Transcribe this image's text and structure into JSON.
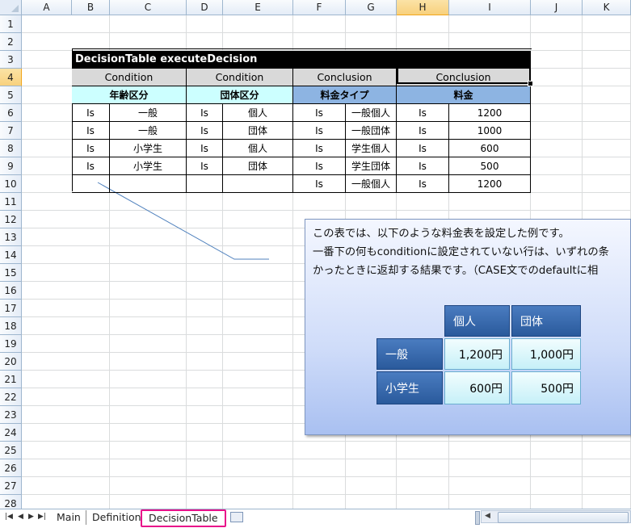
{
  "columns": [
    "A",
    "B",
    "C",
    "D",
    "E",
    "F",
    "G",
    "H",
    "I",
    "J",
    "K"
  ],
  "rows": [
    "1",
    "2",
    "3",
    "4",
    "5",
    "6",
    "7",
    "8",
    "9",
    "10",
    "11",
    "12",
    "13",
    "14",
    "15",
    "16",
    "17",
    "18",
    "19",
    "20",
    "21",
    "22",
    "23",
    "24",
    "25",
    "26",
    "27",
    "28"
  ],
  "selected_column": "H",
  "selected_row": "4",
  "decision_table": {
    "title": "DecisionTable executeDecision",
    "types": [
      "Condition",
      "Condition",
      "Conclusion",
      "Conclusion"
    ],
    "headers": [
      "年齢区分",
      "団体区分",
      "料金タイプ",
      "料金"
    ],
    "rows": [
      [
        "Is",
        "一般",
        "Is",
        "個人",
        "Is",
        "一般個人",
        "Is",
        "1200"
      ],
      [
        "Is",
        "一般",
        "Is",
        "団体",
        "Is",
        "一般団体",
        "Is",
        "1000"
      ],
      [
        "Is",
        "小学生",
        "Is",
        "個人",
        "Is",
        "学生個人",
        "Is",
        "600"
      ],
      [
        "Is",
        "小学生",
        "Is",
        "団体",
        "Is",
        "学生団体",
        "Is",
        "500"
      ],
      [
        "",
        "",
        "",
        "",
        "Is",
        "一般個人",
        "Is",
        "1200"
      ]
    ]
  },
  "note": {
    "lines": [
      "この表では、以下のような料金表を設定した例です。",
      "一番下の何もconditionに設定されていない行は、いずれの条",
      "かったときに返却する結果です。（CASE文でのdefaultに相"
    ],
    "price_table": {
      "col_headers": [
        "個人",
        "団体"
      ],
      "row_headers": [
        "一般",
        "小学生"
      ],
      "values": [
        [
          "1,200円",
          "1,000円"
        ],
        [
          "600円",
          "500円"
        ]
      ]
    }
  },
  "sheet_tabs": [
    "Main",
    "Definition",
    "DecisionTable"
  ],
  "active_tab": "DecisionTable",
  "colors": {
    "accent_tab_border": "#e8108a",
    "header_cyan": "#ccffff",
    "header_blue": "#8db4e2",
    "title_bg": "#000000"
  }
}
